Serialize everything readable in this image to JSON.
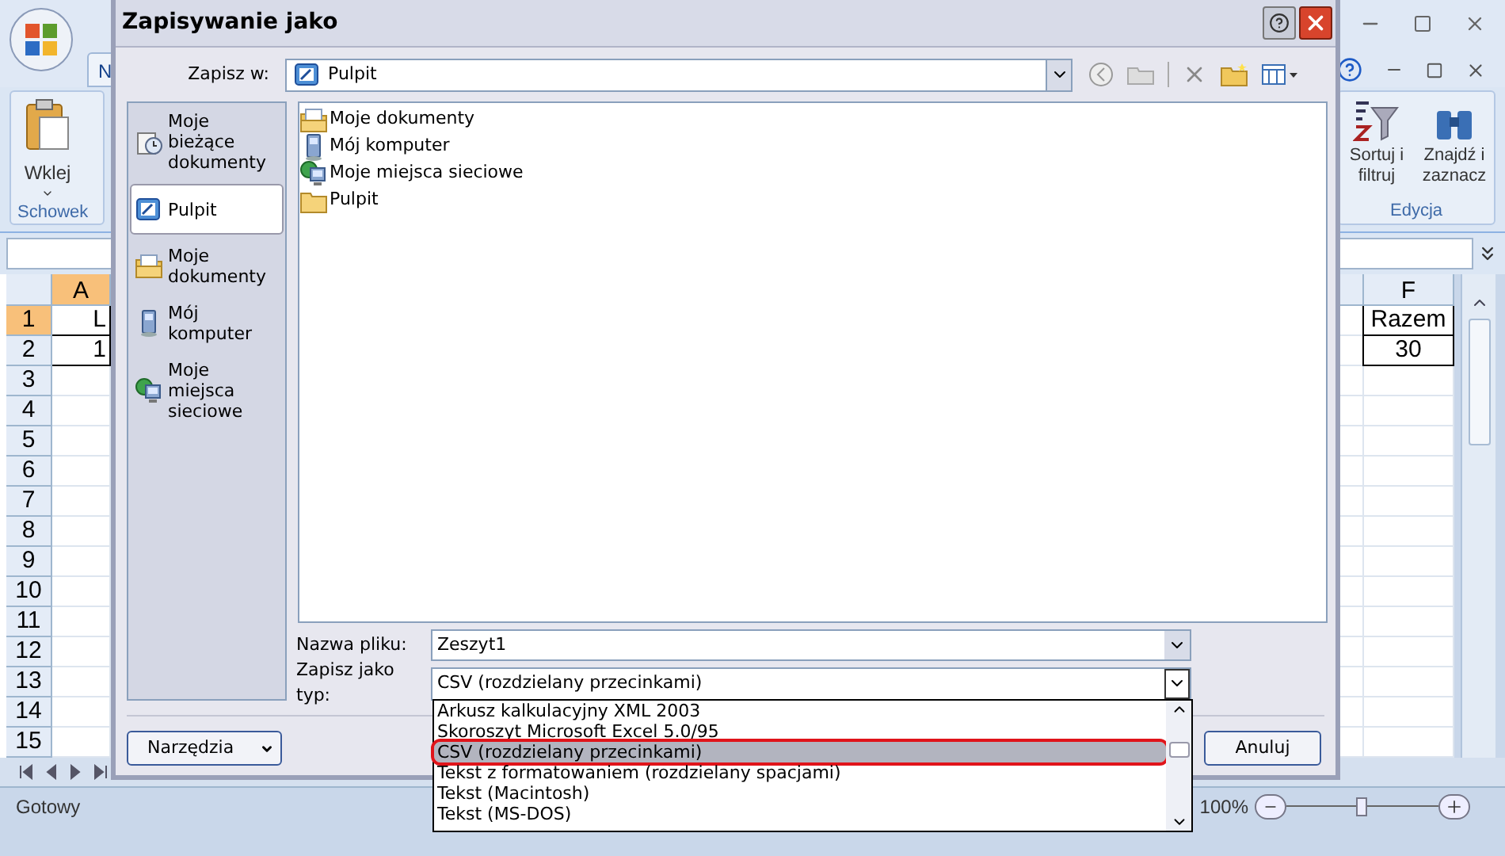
{
  "excel": {
    "tab_label": "N",
    "ribbon": {
      "paste": "Wklej",
      "clipboard_group": "Schowek",
      "sort": [
        "Sortuj i",
        "filtruj"
      ],
      "find": [
        "Znajdź i",
        "zaznacz"
      ],
      "editing_group": "Edycja"
    },
    "columns": [
      {
        "label": "A",
        "selected": true
      },
      {
        "label": "F",
        "selected": false
      }
    ],
    "rows": [
      {
        "label": "1",
        "selected": true,
        "cells": [
          "L",
          "Razem"
        ]
      },
      {
        "label": "2",
        "selected": false,
        "cells": [
          "1",
          "30"
        ]
      },
      {
        "label": "3",
        "selected": false,
        "cells": []
      },
      {
        "label": "4",
        "selected": false,
        "cells": []
      },
      {
        "label": "5",
        "selected": false,
        "cells": []
      },
      {
        "label": "6",
        "selected": false,
        "cells": []
      },
      {
        "label": "7",
        "selected": false,
        "cells": []
      },
      {
        "label": "8",
        "selected": false,
        "cells": []
      },
      {
        "label": "9",
        "selected": false,
        "cells": []
      },
      {
        "label": "10",
        "selected": false,
        "cells": []
      },
      {
        "label": "11",
        "selected": false,
        "cells": []
      },
      {
        "label": "12",
        "selected": false,
        "cells": []
      },
      {
        "label": "13",
        "selected": false,
        "cells": []
      },
      {
        "label": "14",
        "selected": false,
        "cells": []
      },
      {
        "label": "15",
        "selected": false,
        "cells": []
      }
    ],
    "status": "Gotowy",
    "zoom": {
      "reading": "100%",
      "level": 0.5
    }
  },
  "dialog": {
    "title": "Zapisywanie jako",
    "save_in": {
      "label": "Zapisz w:",
      "value": "Pulpit"
    },
    "places": [
      {
        "label": "Moje bieżące dokumenty",
        "kind": "recent",
        "selected": false
      },
      {
        "label": "Pulpit",
        "kind": "desktop",
        "selected": true
      },
      {
        "label": "Moje dokumenty",
        "kind": "documents",
        "selected": false
      },
      {
        "label": "Mój komputer",
        "kind": "computer",
        "selected": false
      },
      {
        "label": "Moje miejsca sieciowe",
        "kind": "network",
        "selected": false
      }
    ],
    "files": [
      {
        "name": "Moje dokumenty",
        "kind": "documents"
      },
      {
        "name": "Mój komputer",
        "kind": "computer"
      },
      {
        "name": "Moje miejsca sieciowe",
        "kind": "network"
      },
      {
        "name": "Pulpit",
        "kind": "folder"
      }
    ],
    "file_name": {
      "label": "Nazwa pliku:",
      "value": "Zeszyt1"
    },
    "file_type": {
      "label": "Zapisz jako typ:",
      "value": "CSV (rozdzielany przecinkami)",
      "options": [
        {
          "label": "Arkusz kalkulacyjny XML 2003",
          "selected": false
        },
        {
          "label": "Skoroszyt Microsoft Excel 5.0/95",
          "selected": false
        },
        {
          "label": "CSV (rozdzielany przecinkami)",
          "selected": true
        },
        {
          "label": "Tekst z formatowaniem (rozdzielany spacjami)",
          "selected": false
        },
        {
          "label": "Tekst (Macintosh)",
          "selected": false
        },
        {
          "label": "Tekst (MS-DOS)",
          "selected": false
        }
      ]
    },
    "tools_button": "Narzędzia",
    "cancel_button": "Anuluj"
  }
}
